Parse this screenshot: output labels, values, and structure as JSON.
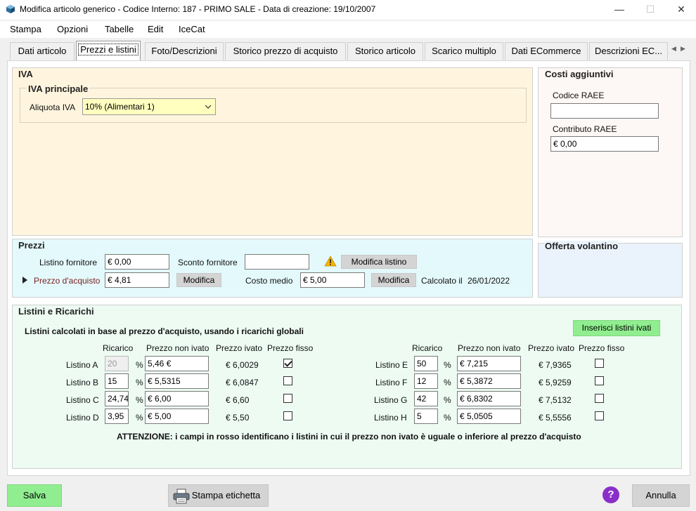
{
  "window": {
    "title": "Modifica articolo generico - Codice Interno: 187 - PRIMO SALE - Data di creazione: 19/10/2007",
    "minimize": "—",
    "maximize": "☐",
    "close": "✕"
  },
  "menu": [
    "Stampa",
    "Opzioni",
    "Tabelle",
    "Edit",
    "IceCat"
  ],
  "tabs": [
    "Dati articolo",
    "Prezzi e listini",
    "Foto/Descrizioni",
    "Storico prezzo di acquisto",
    "Storico articolo",
    "Scarico multiplo",
    "Dati ECommerce",
    "Descrizioni EC..."
  ],
  "tab_scroll": {
    "left": "◀",
    "right": "▶"
  },
  "iva": {
    "title": "IVA",
    "sub_title": "IVA principale",
    "aliquota_label": "Aliquota IVA",
    "aliquota_value": "10% (Alimentari 1)"
  },
  "costi": {
    "title": "Costi aggiuntivi",
    "raee_label": "Codice RAEE",
    "raee_value": "",
    "contributo_label": "Contributo RAEE",
    "contributo_value": "€ 0,00"
  },
  "prezzi": {
    "title": "Prezzi",
    "listino_fornitore_label": "Listino fornitore",
    "listino_fornitore_value": "€ 0,00",
    "sconto_label": "Sconto fornitore",
    "sconto_value": "",
    "modifica_listino": "Modifica listino",
    "prezzo_acquisto_label": "Prezzo d'acquisto",
    "prezzo_acquisto_value": "€ 4,81",
    "modifica1": "Modifica",
    "costo_medio_label": "Costo medio",
    "costo_medio_value": "€ 5,00",
    "modifica2": "Modifica",
    "calcolato_label": "Calcolato il",
    "calcolato_value": "26/01/2022"
  },
  "offerta": {
    "title": "Offerta volantino"
  },
  "listini": {
    "title": "Listini e Ricarichi",
    "subtitle": "Listini calcolati in base al prezzo d'acquisto, usando i ricarichi globali",
    "inserisci_button": "Inserisci listini ivati",
    "headers": {
      "ricarico": "Ricarico",
      "non_ivato": "Prezzo non ivato",
      "ivato": "Prezzo ivato",
      "fisso": "Prezzo fisso"
    },
    "pct": "%",
    "left": [
      {
        "name": "Listino A",
        "ricarico": "20",
        "non_ivato": "5,46 €",
        "ivato": "€ 6,0029",
        "fisso": true
      },
      {
        "name": "Listino B",
        "ricarico": "15",
        "non_ivato": "€ 5,5315",
        "ivato": "€ 6,0847",
        "fisso": false
      },
      {
        "name": "Listino C",
        "ricarico": "24,74",
        "non_ivato": "€ 6,00",
        "ivato": "€ 6,60",
        "fisso": false
      },
      {
        "name": "Listino D",
        "ricarico": "3,95",
        "non_ivato": "€ 5,00",
        "ivato": "€ 5,50",
        "fisso": false
      }
    ],
    "right": [
      {
        "name": "Listino E",
        "ricarico": "50",
        "non_ivato": "€ 7,215",
        "ivato": "€ 7,9365",
        "fisso": false
      },
      {
        "name": "Listino F",
        "ricarico": "12",
        "non_ivato": "€ 5,3872",
        "ivato": "€ 5,9259",
        "fisso": false
      },
      {
        "name": "Listino G",
        "ricarico": "42",
        "non_ivato": "€ 6,8302",
        "ivato": "€ 7,5132",
        "fisso": false
      },
      {
        "name": "Listino H",
        "ricarico": "5",
        "non_ivato": "€ 5,0505",
        "ivato": "€ 5,5556",
        "fisso": false
      }
    ],
    "attenzione": "ATTENZIONE: i campi in rosso identificano i listini in cui il prezzo non ivato è uguale o inferiore al prezzo d'acquisto"
  },
  "footer": {
    "salva": "Salva",
    "stampa_etichetta": "Stampa etichetta",
    "help": "?",
    "annulla": "Annulla"
  },
  "colors": {
    "iva_bg": "#fff5de",
    "costi_bg": "#fdf7f5",
    "prezzi_bg": "#e4f9fc",
    "offerta_bg": "#eaf3fb",
    "listini_bg": "#edfbf3",
    "green_button": "#90ee90",
    "select_bg": "#ffffc0",
    "help_purple": "#8b2fc9"
  }
}
